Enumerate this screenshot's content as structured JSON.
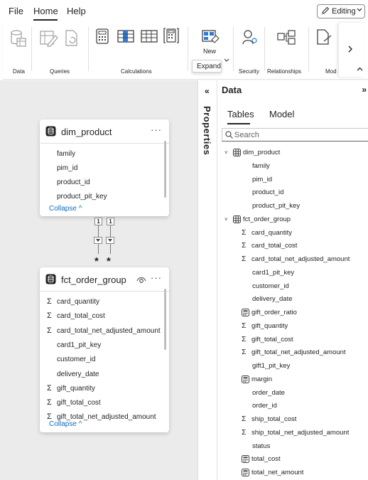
{
  "menu": {
    "file": "File",
    "home": "Home",
    "help": "Help",
    "editing": "Editing"
  },
  "ribbon": {
    "groups": [
      "Data",
      "Queries",
      "Calculations",
      "Security",
      "Relationships",
      "Mod"
    ],
    "new_label": "New",
    "tooltip": "Expand"
  },
  "canvas": {
    "dim_product": {
      "title": "dim_product",
      "fields": [
        "family",
        "pim_id",
        "product_id",
        "product_pit_key"
      ],
      "collapse": "Collapse"
    },
    "fct_order_group": {
      "title": "fct_order_group",
      "fields": [
        {
          "name": "card_quantity",
          "sigma": true
        },
        {
          "name": "card_total_cost",
          "sigma": true
        },
        {
          "name": "card_total_net_adjusted_amount",
          "sigma": true
        },
        {
          "name": "card1_pit_key",
          "sigma": false
        },
        {
          "name": "customer_id",
          "sigma": false
        },
        {
          "name": "delivery_date",
          "sigma": false
        },
        {
          "name": "gift_quantity",
          "sigma": true
        },
        {
          "name": "gift_total_cost",
          "sigma": true
        },
        {
          "name": "gift_total_net_adjusted_amount",
          "sigma": true
        }
      ],
      "collapse": "Collapse"
    },
    "relationship": {
      "one_left": "1",
      "one_right": "1",
      "many_left": "*",
      "many_right": "*"
    }
  },
  "properties": {
    "label": "Properties",
    "collapse_icon": "«"
  },
  "data_pane": {
    "title": "Data",
    "close_icon": "»",
    "tabs": [
      "Tables",
      "Model"
    ],
    "search_placeholder": "Search",
    "tables": [
      {
        "name": "dim_product",
        "columns": [
          {
            "name": "family",
            "kind": "plain"
          },
          {
            "name": "pim_id",
            "kind": "plain"
          },
          {
            "name": "product_id",
            "kind": "plain"
          },
          {
            "name": "product_pit_key",
            "kind": "plain"
          }
        ]
      },
      {
        "name": "fct_order_group",
        "columns": [
          {
            "name": "card_quantity",
            "kind": "sigma"
          },
          {
            "name": "card_total_cost",
            "kind": "sigma"
          },
          {
            "name": "card_total_net_adjusted_amount",
            "kind": "sigma"
          },
          {
            "name": "card1_pit_key",
            "kind": "plain"
          },
          {
            "name": "customer_id",
            "kind": "plain"
          },
          {
            "name": "delivery_date",
            "kind": "plain"
          },
          {
            "name": "gift_order_ratio",
            "kind": "measure"
          },
          {
            "name": "gift_quantity",
            "kind": "sigma"
          },
          {
            "name": "gift_total_cost",
            "kind": "sigma"
          },
          {
            "name": "gift_total_net_adjusted_amount",
            "kind": "sigma"
          },
          {
            "name": "gift1_pit_key",
            "kind": "plain"
          },
          {
            "name": "margin",
            "kind": "measure"
          },
          {
            "name": "order_date",
            "kind": "plain"
          },
          {
            "name": "order_id",
            "kind": "plain"
          },
          {
            "name": "ship_total_cost",
            "kind": "sigma"
          },
          {
            "name": "ship_total_net_adjusted_amount",
            "kind": "sigma"
          },
          {
            "name": "status",
            "kind": "plain"
          },
          {
            "name": "total_cost",
            "kind": "measure"
          },
          {
            "name": "total_net_amount",
            "kind": "measure"
          }
        ]
      }
    ]
  },
  "colors": {
    "canvas_bg": "#ebebeb",
    "link": "#0f6cbd"
  }
}
